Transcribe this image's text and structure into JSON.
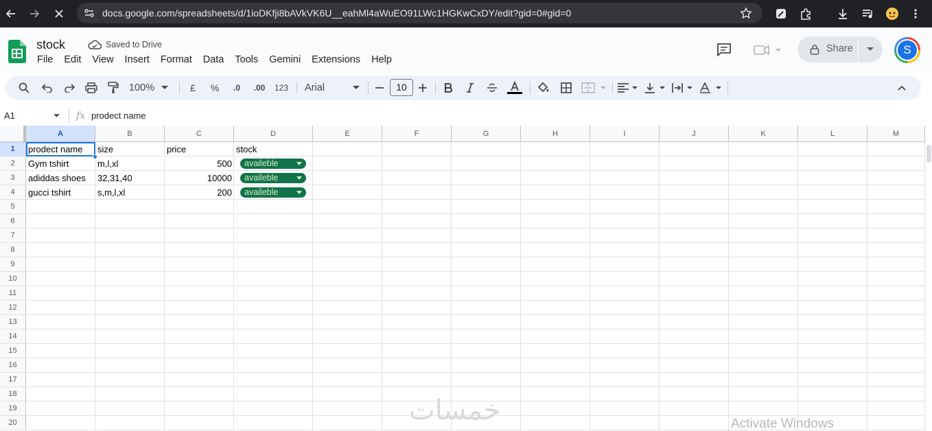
{
  "browser": {
    "url": "docs.google.com/spreadsheets/d/1ioDKfji8bAVkVK6U__eahMl4aWuEO91LWc1HGKwCxDY/edit?gid=0#gid=0"
  },
  "app": {
    "title": "stock",
    "save_status": "Saved to Drive",
    "menu": [
      "File",
      "Edit",
      "View",
      "Insert",
      "Format",
      "Data",
      "Tools",
      "Gemini",
      "Extensions",
      "Help"
    ],
    "share_label": "Share",
    "avatar_initial": "S"
  },
  "toolbar": {
    "zoom": "100%",
    "currency": "£",
    "percent": "%",
    "decrease_decimal": ".0",
    "increase_decimal": ".00",
    "number_format": "123",
    "font": "Arial",
    "font_size": "10"
  },
  "formula_bar": {
    "cell_ref": "A1",
    "fx": "fx",
    "value": "prodect name"
  },
  "sheet": {
    "columns": [
      "A",
      "B",
      "C",
      "D",
      "E",
      "F",
      "G",
      "H",
      "I",
      "J",
      "K",
      "L",
      "M"
    ],
    "rows": [
      "1",
      "2",
      "3",
      "4",
      "5",
      "6",
      "7",
      "8",
      "9",
      "10",
      "11",
      "12",
      "13",
      "14",
      "15",
      "16",
      "17",
      "18",
      "19",
      "20"
    ],
    "header": [
      "prodect name",
      "size",
      "price",
      "stock"
    ],
    "data": [
      {
        "name": "Gym tshirt",
        "size": "m,l,xl",
        "price": "500",
        "stock": "availeble"
      },
      {
        "name": "adiddas shoes",
        "size": "32,31,40",
        "price": "10000",
        "stock": "availeble"
      },
      {
        "name": "gucci tshirt",
        "size": "s,m,l,xl",
        "price": "200",
        "stock": "availeble"
      }
    ],
    "chip_color": "#11734b",
    "selection_color": "#1a73e8"
  },
  "overlay": {
    "watermark": "خمسات",
    "activate_windows": "Activate Windows"
  }
}
